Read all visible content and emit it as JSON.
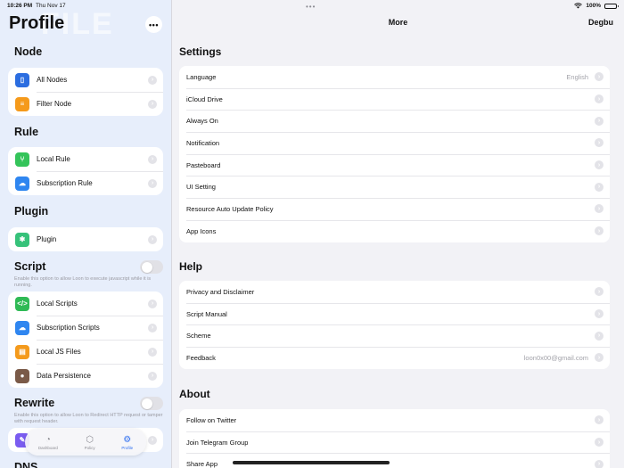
{
  "status": {
    "time": "10:26 PM",
    "date": "Thu Nov 17",
    "battery": "100%",
    "battery_level": 1.0
  },
  "sidebar": {
    "title": "Profile",
    "watermark": "FILE",
    "more_label": "•••",
    "sections": {
      "node": "Node",
      "rule": "Rule",
      "plugin": "Plugin",
      "script": "Script",
      "rewrite": "Rewrite",
      "dns": "DNS"
    },
    "node_items": [
      {
        "label": "All Nodes",
        "icon": "server-icon",
        "color": "#2b6de0"
      },
      {
        "label": "Filter Node",
        "icon": "filter-icon",
        "color": "#f59a1b"
      }
    ],
    "rule_items": [
      {
        "label": "Local Rule",
        "icon": "branch-icon",
        "color": "#34c45a"
      },
      {
        "label": "Subscription Rule",
        "icon": "cloud-icon",
        "color": "#2f86f0"
      }
    ],
    "plugin_items": [
      {
        "label": "Plugin",
        "icon": "puzzle-icon",
        "color": "#36c27a"
      }
    ],
    "script_toggle": false,
    "script_note": "Enable this option to allow Loon to execute javascript while it is running.",
    "script_items": [
      {
        "label": "Local Scripts",
        "icon": "code-icon",
        "color": "#2fba55"
      },
      {
        "label": "Subscription Scripts",
        "icon": "cloud-icon",
        "color": "#2f86f0"
      },
      {
        "label": "Local JS Files",
        "icon": "file-icon",
        "color": "#f49a1c"
      },
      {
        "label": "Data Persistence",
        "icon": "cookie-icon",
        "color": "#7a5a48"
      }
    ],
    "rewrite_toggle": false,
    "rewrite_note": "Enable this option to allow Loon to Redirect HTTP request or tamper with request header."
  },
  "tabbar": {
    "items": [
      {
        "label": "Dashboard",
        "icon": "gauge-icon"
      },
      {
        "label": "Policy",
        "icon": "cube-icon"
      },
      {
        "label": "Profile",
        "icon": "gear-icon"
      }
    ],
    "active": "Profile",
    "accent": "#2f6ff0"
  },
  "main": {
    "title": "More",
    "action": "Degbu",
    "settings": {
      "heading": "Settings",
      "rows": [
        {
          "label": "Language",
          "value": "English"
        },
        {
          "label": "iCloud Drive",
          "value": ""
        },
        {
          "label": "Always On",
          "value": ""
        },
        {
          "label": "Notification",
          "value": ""
        },
        {
          "label": "Pasteboard",
          "value": ""
        },
        {
          "label": "UI Setting",
          "value": ""
        },
        {
          "label": "Resource Auto Update Policy",
          "value": ""
        },
        {
          "label": "App Icons",
          "value": ""
        }
      ]
    },
    "help": {
      "heading": "Help",
      "rows": [
        {
          "label": "Privacy and Disclaimer",
          "value": ""
        },
        {
          "label": "Script Manual",
          "value": ""
        },
        {
          "label": "Scheme",
          "value": ""
        },
        {
          "label": "Feedback",
          "value": "loon0x00@gmail.com"
        }
      ]
    },
    "about": {
      "heading": "About",
      "rows": [
        {
          "label": "Follow on Twitter",
          "value": ""
        },
        {
          "label": "Join Telegram Group",
          "value": ""
        },
        {
          "label": "Share App",
          "value": ""
        }
      ]
    }
  }
}
